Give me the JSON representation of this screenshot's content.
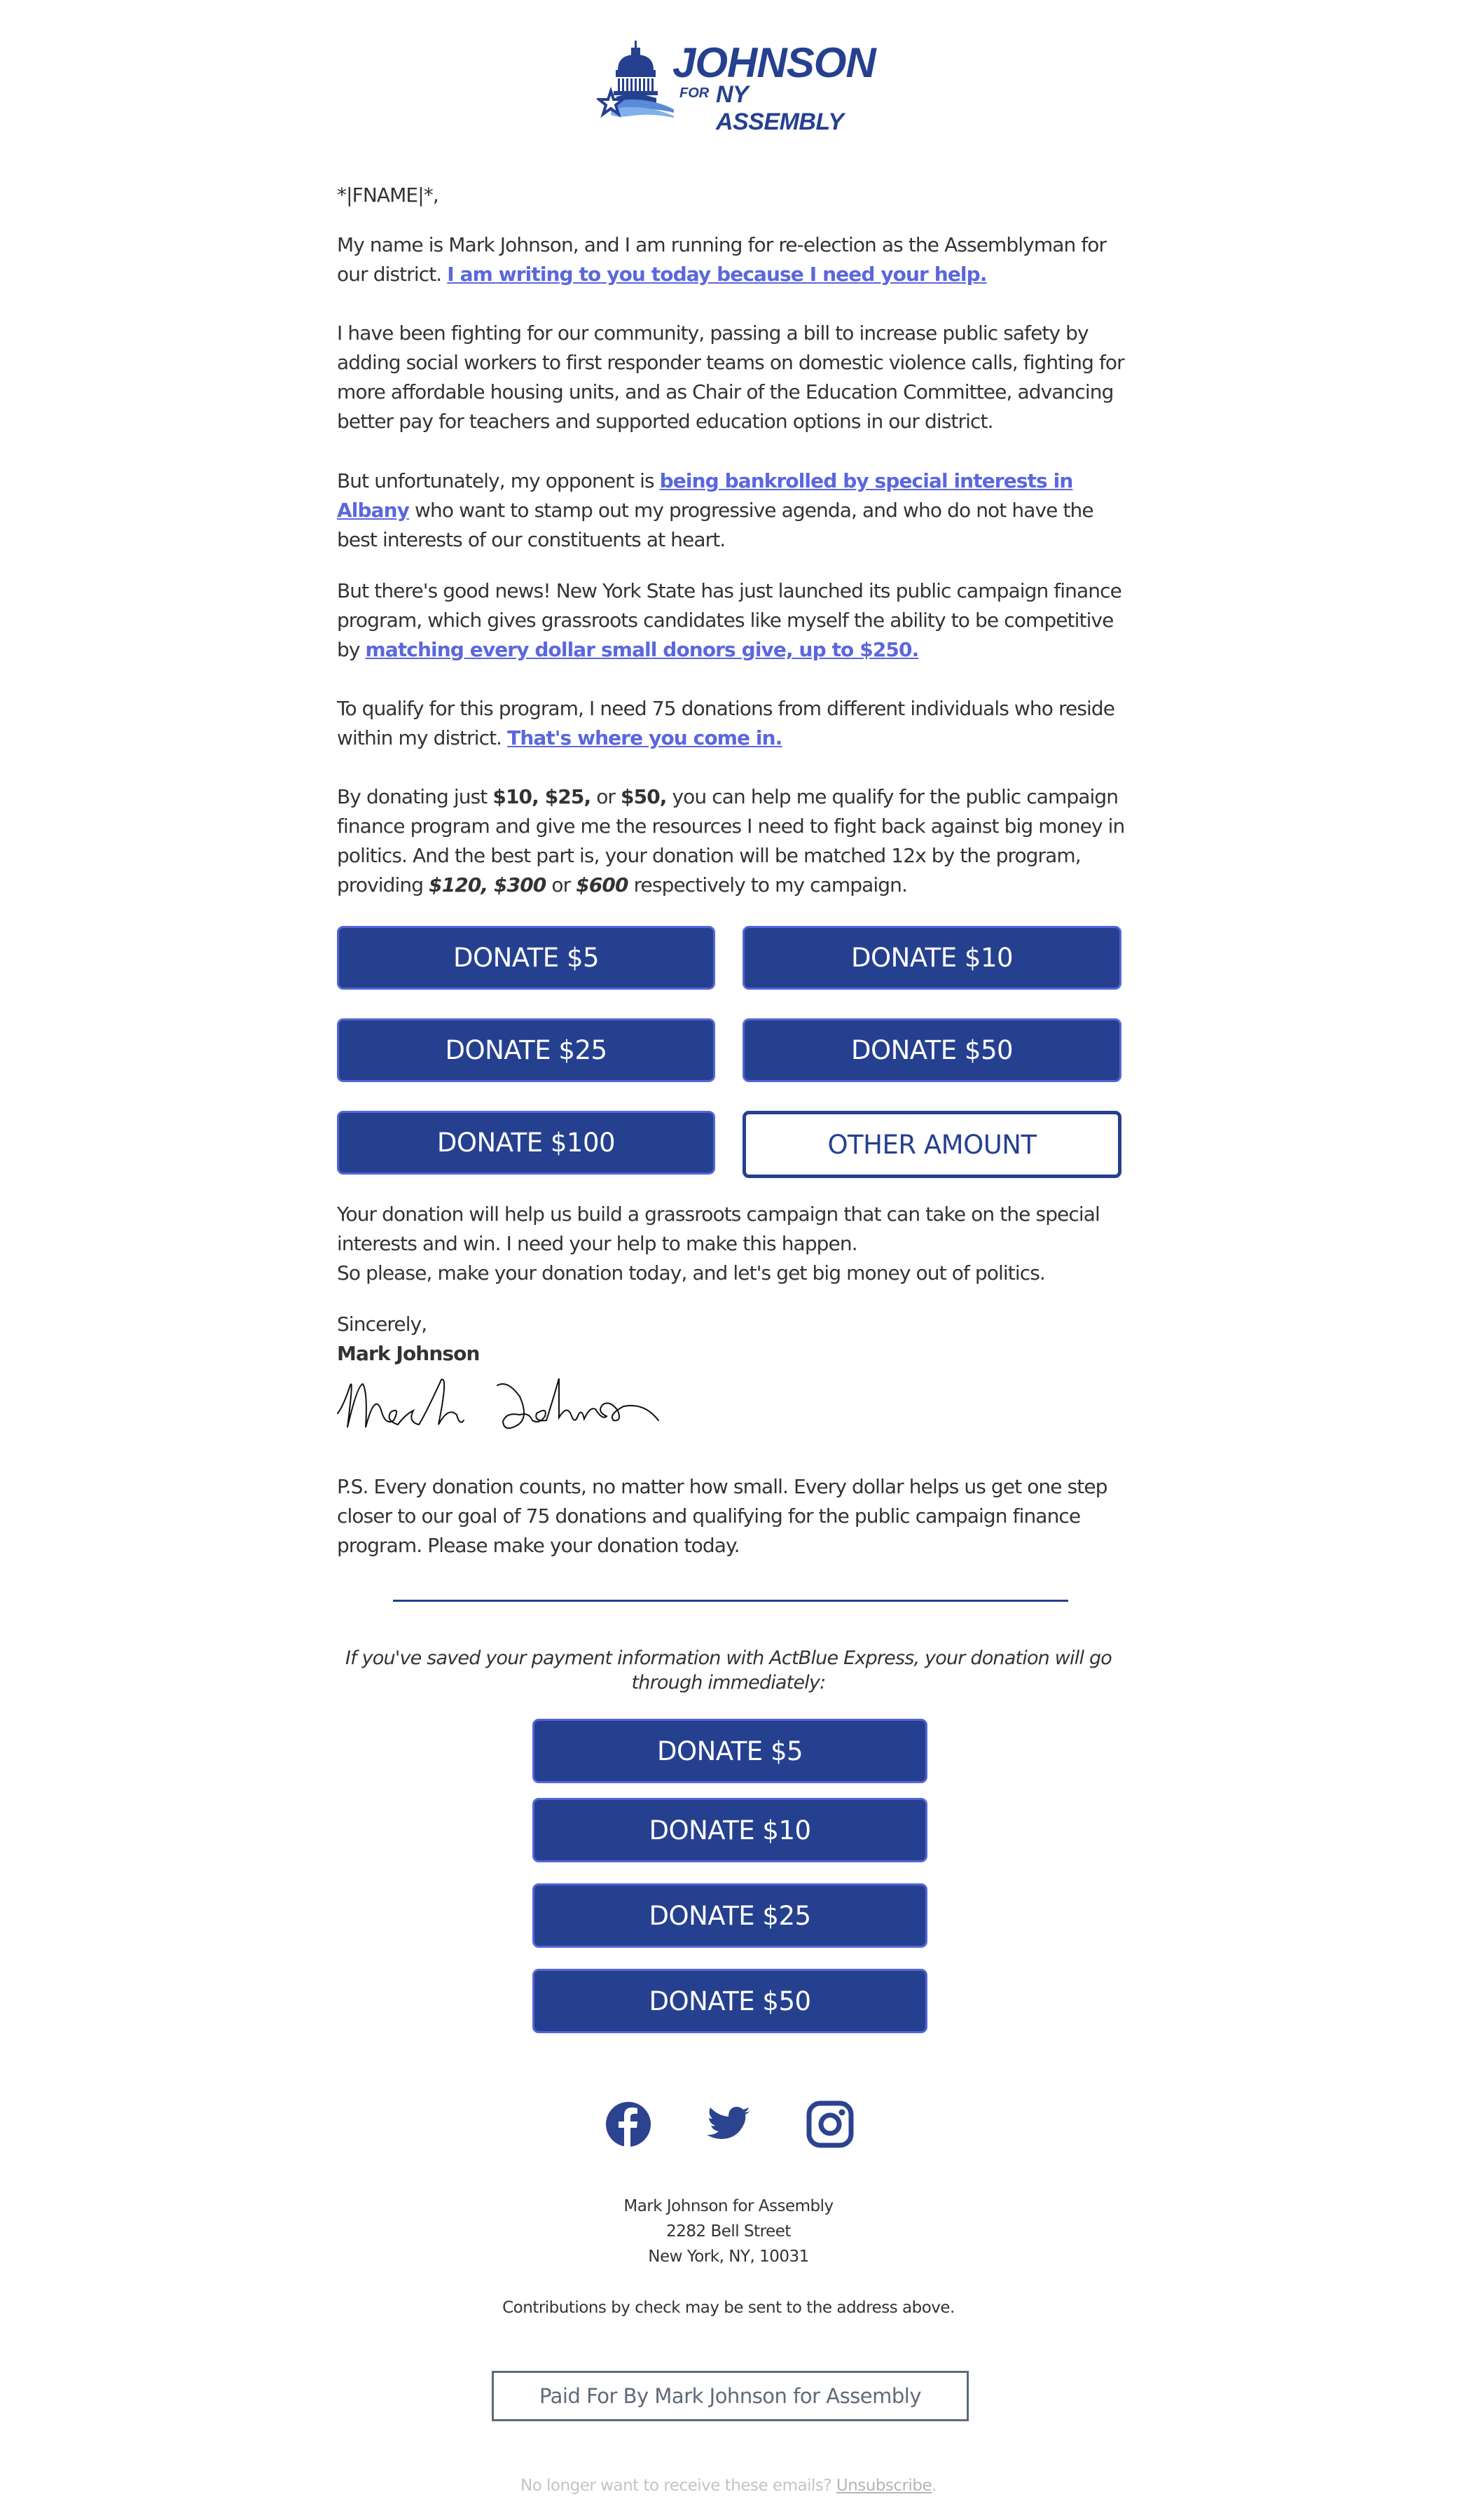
{
  "brand": {
    "name": "JOHNSON",
    "for": "FOR",
    "subtitle": "NY ASSEMBLY",
    "primary_color": "#25408f",
    "link_color": "#5b67dc"
  },
  "letter": {
    "greeting": "*|FNAME|*,",
    "p1": {
      "text": "My name is Mark Johnson, and I am running for re-election as the Assemblyman for our district. ",
      "link": "I am writing to you today because I need your help."
    },
    "p2": "I have been fighting for our community, passing a bill to increase public safety by adding social workers to first responder teams on domestic violence calls, fighting for more affordable housing units, and as Chair of the Education Committee, advancing better pay for teachers and supported education options in our district.",
    "p3": {
      "before": "But unfortunately, my opponent is ",
      "link": "being bankrolled by special interests in Albany",
      "after": " who want to stamp out my progressive agenda, and who do not have the best interests of our constituents at heart."
    },
    "p4": {
      "before": "But there's good news! New York State has just launched its public campaign finance program, which gives grassroots candidates like myself the ability to be competitive by ",
      "link": "matching every dollar small donors give, up to $250."
    },
    "p5": {
      "before": "To qualify for this program, I need 75 donations from different individuals who reside within my district. ",
      "link": "That's where you come in."
    },
    "p6": {
      "t1": "By donating just ",
      "b1": "$10, $25,",
      "t2": " or ",
      "b2": "$50,",
      "t3": " you can help me qualify for the public campaign finance program and give me the resources I need to fight back against big money in politics. And the best part is, your donation will be matched 12x by the program, providing ",
      "bi1": "$120, $300",
      "t4": " or ",
      "bi2": "$600",
      "t5": " respectively to my campaign."
    },
    "p7_line1": "Your donation will help us build a grassroots campaign that can take on the special interests and win. I need your help to make this happen.",
    "p7_line2": "So please, make your donation today, and let's get big money out of politics.",
    "closing": "Sincerely,",
    "signer": "Mark Johnson",
    "ps": "P.S. Every donation counts, no matter how small. Every dollar helps us get one step closer to our goal of 75 donations and qualifying for the public campaign finance program. Please make your donation today."
  },
  "donate_grid": [
    {
      "label": "DONATE $5"
    },
    {
      "label": "DONATE $10"
    },
    {
      "label": "DONATE $25"
    },
    {
      "label": "DONATE $50"
    },
    {
      "label": "DONATE $100"
    },
    {
      "label": "OTHER AMOUNT"
    }
  ],
  "express": {
    "note": "If you've saved your payment information with ActBlue Express, your donation will go through immediately:",
    "buttons": [
      {
        "label": "DONATE $5"
      },
      {
        "label": "DONATE $10"
      },
      {
        "label": "DONATE $25"
      },
      {
        "label": "DONATE $50"
      }
    ]
  },
  "social": [
    {
      "name": "facebook",
      "icon": "facebook-icon"
    },
    {
      "name": "twitter",
      "icon": "twitter-icon"
    },
    {
      "name": "instagram",
      "icon": "instagram-icon"
    }
  ],
  "footer": {
    "org": "Mark Johnson for Assembly",
    "street": "2282 Bell Street",
    "city": "New York, NY, 10031",
    "check_note": "Contributions by check may be sent to the address above.",
    "paid_for": "Paid For By Mark Johnson for Assembly",
    "unsub_text": "No longer want to receive these emails? ",
    "unsub_link": "Unsubscribe",
    "unsub_end": "."
  }
}
